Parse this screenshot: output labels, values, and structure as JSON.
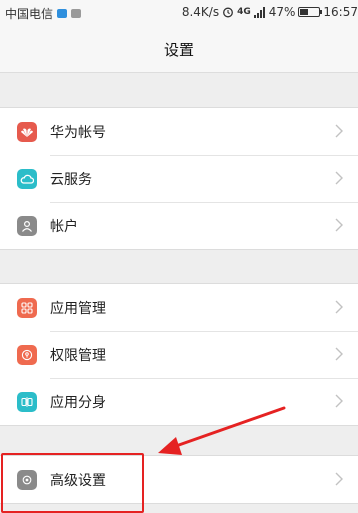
{
  "status_bar": {
    "carrier": "中国电信",
    "speed": "8.4K/s",
    "network": "4G",
    "battery": "47%",
    "battery_level": 0.47,
    "time": "16:57"
  },
  "header": {
    "title": "设置"
  },
  "groups": [
    {
      "items": [
        {
          "label": "华为帐号",
          "icon": "huawei-logo-icon",
          "icon_color": "#e65a4d"
        },
        {
          "label": "云服务",
          "icon": "cloud-icon",
          "icon_color": "#2bbdc9"
        },
        {
          "label": "帐户",
          "icon": "user-icon",
          "icon_color": "#8a8a8a"
        }
      ]
    },
    {
      "items": [
        {
          "label": "应用管理",
          "icon": "grid-icon",
          "icon_color": "#ef6a4f"
        },
        {
          "label": "权限管理",
          "icon": "shield-icon",
          "icon_color": "#ef6a4f"
        },
        {
          "label": "应用分身",
          "icon": "twin-app-icon",
          "icon_color": "#2bbdc9"
        }
      ]
    },
    {
      "items": [
        {
          "label": "高级设置",
          "icon": "gear-icon",
          "icon_color": "#8a8a8a"
        }
      ]
    }
  ],
  "annotation": {
    "color": "#e52222"
  }
}
